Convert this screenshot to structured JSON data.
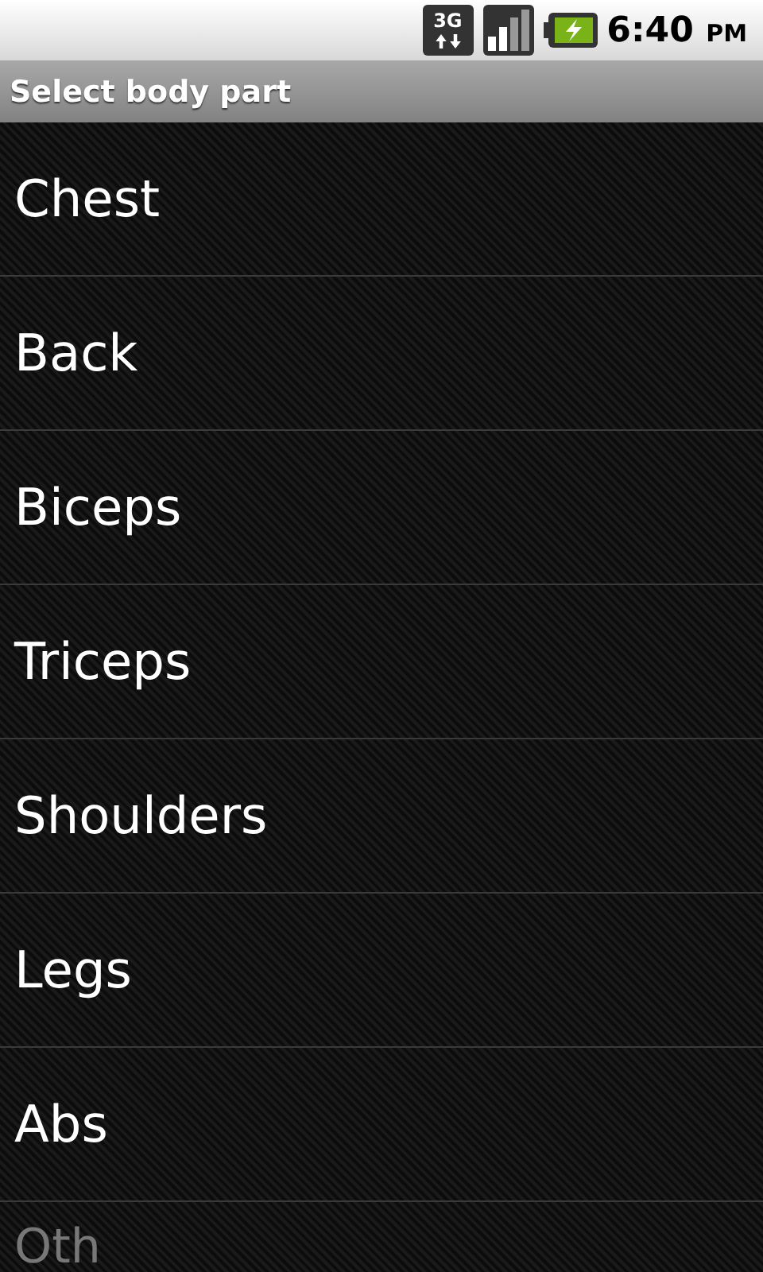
{
  "status_bar": {
    "network": "3G",
    "time": "6:40",
    "ampm": "PM"
  },
  "title_bar": {
    "title": "Select body part"
  },
  "items": [
    {
      "label": "Chest"
    },
    {
      "label": "Back"
    },
    {
      "label": "Biceps"
    },
    {
      "label": "Triceps"
    },
    {
      "label": "Shoulders"
    },
    {
      "label": "Legs"
    },
    {
      "label": "Abs"
    },
    {
      "label": "Oth",
      "faded": true
    }
  ]
}
